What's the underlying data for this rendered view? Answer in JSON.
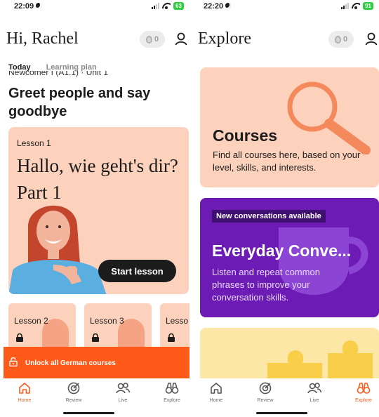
{
  "left_screen": {
    "status": {
      "time": "22:09",
      "battery": "63"
    },
    "greeting": "Hi, Rachel",
    "streak": "0",
    "tabs": [
      {
        "label": "Today"
      },
      {
        "label": "Learning plan"
      }
    ],
    "course_level": "Newcomer I (A1.1) · Unit 1",
    "unit_title": "Greet people and say goodbye",
    "lesson_card": {
      "label": "Lesson 1",
      "title": "Hallo, wie geht's dir? Part 1",
      "button": "Start lesson"
    },
    "mini_lessons": [
      {
        "label": "Lesson 2"
      },
      {
        "label": "Lesson 3"
      },
      {
        "label": "Lesso"
      }
    ],
    "unlock_banner": "Unlock all German courses",
    "nav": [
      {
        "label": "Home",
        "icon": "home-icon",
        "active": true
      },
      {
        "label": "Review",
        "icon": "target-icon",
        "active": false
      },
      {
        "label": "Live",
        "icon": "people-icon",
        "active": false
      },
      {
        "label": "Explore",
        "icon": "binoculars-icon",
        "active": false
      }
    ]
  },
  "right_screen": {
    "status": {
      "time": "22:20",
      "battery": "91"
    },
    "page_title": "Explore",
    "streak": "0",
    "courses_card": {
      "title": "Courses",
      "description": "Find all courses here, based on your level, skills, and interests."
    },
    "conversation_card": {
      "badge": "New conversations available",
      "title": "Everyday Conve...",
      "description": "Listen and repeat common phrases to improve your conversation skills."
    },
    "nav": [
      {
        "label": "Home",
        "icon": "home-icon",
        "active": false
      },
      {
        "label": "Review",
        "icon": "target-icon",
        "active": false
      },
      {
        "label": "Live",
        "icon": "people-icon",
        "active": false
      },
      {
        "label": "Explore",
        "icon": "binoculars-icon",
        "active": true
      }
    ]
  },
  "colors": {
    "accent": "#ff5a1a",
    "peach": "#fdd2bd",
    "purple": "#6c1bb5",
    "yellow": "#fde7a7"
  }
}
